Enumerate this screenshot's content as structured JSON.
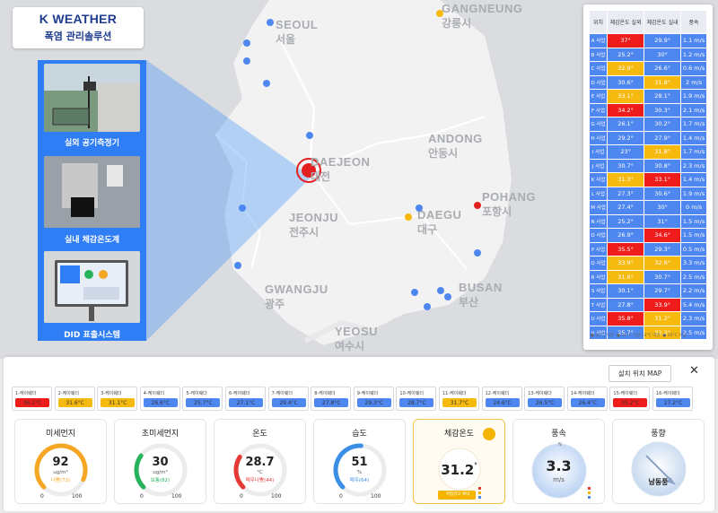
{
  "logo": {
    "brand": "K WEATHER",
    "subtitle": "폭염 관리솔루션"
  },
  "map": {
    "cities": [
      {
        "en": "SEOUL",
        "ko": "서울"
      },
      {
        "en": "GANGNEUNG",
        "ko": "강릉시"
      },
      {
        "en": "ANDONG",
        "ko": "안동시"
      },
      {
        "en": "DAEJEON",
        "ko": "대전"
      },
      {
        "en": "POHANG",
        "ko": "포항시"
      },
      {
        "en": "JEONJU",
        "ko": "전주시"
      },
      {
        "en": "DAEGU",
        "ko": "대구"
      },
      {
        "en": "BUSAN",
        "ko": "부산"
      },
      {
        "en": "GWANGJU",
        "ko": "광주"
      },
      {
        "en": "YEOSU",
        "ko": "여수시"
      }
    ]
  },
  "photos": {
    "outdoor": "실외 공기측정기",
    "indoor": "실내 체감온도계",
    "did": "DID 표출시스템"
  },
  "table": {
    "headers": [
      "위치",
      "체감온도 실외",
      "체감온도 실내",
      "풍속"
    ],
    "rows": [
      {
        "loc": "A 사업",
        "out": "37°",
        "outc": "red",
        "in": "29.9°",
        "inc": "blu",
        "wind": "1.1 m/s"
      },
      {
        "loc": "B 사업",
        "out": "25.2°",
        "outc": "blu",
        "in": "30°",
        "inc": "blu",
        "wind": "1.2 m/s"
      },
      {
        "loc": "C 사업",
        "out": "32.9°",
        "outc": "yel",
        "in": "26.6°",
        "inc": "blu",
        "wind": "0.6 m/s"
      },
      {
        "loc": "D 사업",
        "out": "30.6°",
        "outc": "blu",
        "in": "31.8°",
        "inc": "yel",
        "wind": "2 m/s"
      },
      {
        "loc": "E 사업",
        "out": "33.1°",
        "outc": "yel",
        "in": "28.1°",
        "inc": "blu",
        "wind": "1.9 m/s"
      },
      {
        "loc": "F 사업",
        "out": "34.2°",
        "outc": "red",
        "in": "30.3°",
        "inc": "blu",
        "wind": "2.1 m/s"
      },
      {
        "loc": "G 사업",
        "out": "26.1°",
        "outc": "blu",
        "in": "30.2°",
        "inc": "blu",
        "wind": "1.7 m/s"
      },
      {
        "loc": "H 사업",
        "out": "29.2°",
        "outc": "blu",
        "in": "27.9°",
        "inc": "blu",
        "wind": "1.4 m/s"
      },
      {
        "loc": "I 사업",
        "out": "23°",
        "outc": "blu",
        "in": "31.8°",
        "inc": "yel",
        "wind": "1.7 m/s"
      },
      {
        "loc": "J 사업",
        "out": "30.7°",
        "outc": "blu",
        "in": "30.8°",
        "inc": "blu",
        "wind": "2.3 m/s"
      },
      {
        "loc": "K 사업",
        "out": "31.3°",
        "outc": "yel",
        "in": "33.1°",
        "inc": "red",
        "wind": "1.4 m/s"
      },
      {
        "loc": "L 사업",
        "out": "27.3°",
        "outc": "blu",
        "in": "30.6°",
        "inc": "blu",
        "wind": "1.9 m/s"
      },
      {
        "loc": "M 사업",
        "out": "27.4°",
        "outc": "blu",
        "in": "30°",
        "inc": "blu",
        "wind": "0 m/s"
      },
      {
        "loc": "N 사업",
        "out": "25.2°",
        "outc": "blu",
        "in": "31°",
        "inc": "blu",
        "wind": "1.5 m/s"
      },
      {
        "loc": "O 사업",
        "out": "26.9°",
        "outc": "blu",
        "in": "34.6°",
        "inc": "red",
        "wind": "1.5 m/s"
      },
      {
        "loc": "P 사업",
        "out": "35.5°",
        "outc": "red",
        "in": "29.3°",
        "inc": "blu",
        "wind": "0.5 m/s"
      },
      {
        "loc": "Q 사업",
        "out": "33.9°",
        "outc": "yel",
        "in": "32.6°",
        "inc": "yel",
        "wind": "3.3 m/s"
      },
      {
        "loc": "R 사업",
        "out": "31.6°",
        "outc": "yel",
        "in": "30.7°",
        "inc": "blu",
        "wind": "2.5 m/s"
      },
      {
        "loc": "S 사업",
        "out": "30.1°",
        "outc": "blu",
        "in": "29.7°",
        "inc": "blu",
        "wind": "2.2 m/s"
      },
      {
        "loc": "T 사업",
        "out": "27.8°",
        "outc": "blu",
        "in": "33.9°",
        "inc": "red",
        "wind": "5.4 m/s"
      },
      {
        "loc": "U 사업",
        "out": "35.8°",
        "outc": "red",
        "in": "31.2°",
        "inc": "yel",
        "wind": "2.3 m/s"
      },
      {
        "loc": "V 사업",
        "out": "25.7°",
        "outc": "blu",
        "in": "32.2°",
        "inc": "yel",
        "wind": "2.5 m/s"
      }
    ]
  },
  "dashboard": {
    "map_button": "설치 위치 MAP",
    "close": "✕",
    "sensors": [
      {
        "name": "1-케이웨더",
        "value": "36.2°C",
        "color": "red"
      },
      {
        "name": "2-케이웨더",
        "value": "31.6°C",
        "color": "yel"
      },
      {
        "name": "3-케이웨더",
        "value": "31.1°C",
        "color": "yel"
      },
      {
        "name": "4-케이웨더",
        "value": "26.6°C",
        "color": "blu"
      },
      {
        "name": "5-케이웨더",
        "value": "25.7°C",
        "color": "blu"
      },
      {
        "name": "6-케이웨더",
        "value": "27.1°C",
        "color": "blu"
      },
      {
        "name": "7-케이웨더",
        "value": "29.4°C",
        "color": "blu"
      },
      {
        "name": "8-케이웨더",
        "value": "27.8°C",
        "color": "blu"
      },
      {
        "name": "9-케이웨더",
        "value": "29.3°C",
        "color": "blu"
      },
      {
        "name": "10-케이웨더",
        "value": "28.7°C",
        "color": "blu"
      },
      {
        "name": "11-케이웨더",
        "value": "31.7°C",
        "color": "yel"
      },
      {
        "name": "12-케이웨더",
        "value": "24.6°C",
        "color": "blu"
      },
      {
        "name": "13-케이웨더",
        "value": "26.5°C",
        "color": "blu"
      },
      {
        "name": "14-케이웨더",
        "value": "26.4°C",
        "color": "blu"
      },
      {
        "name": "15-케이웨더",
        "value": "35.2°C",
        "color": "red"
      },
      {
        "name": "16-케이웨더",
        "value": "27.2°C",
        "color": "blu"
      }
    ],
    "cards": {
      "pm10": {
        "title": "미세먼지",
        "value": "92",
        "unit": "ug/m³",
        "status": "나쁨(73)",
        "min": "0",
        "max": "100",
        "fraction": 0.92,
        "color": "#f5a623"
      },
      "pm25": {
        "title": "초미세먼지",
        "value": "30",
        "unit": "ug/m³",
        "status": "보통(82)",
        "min": "0",
        "max": "100",
        "fraction": 0.3,
        "color": "#27b35c"
      },
      "temp": {
        "title": "온도",
        "value": "28.7",
        "unit": "°C",
        "status": "매우나쁨(44)",
        "min": "0",
        "max": "100",
        "fraction": 0.287,
        "color": "#e53935"
      },
      "humid": {
        "title": "습도",
        "value": "51",
        "unit": "%",
        "status": "매우(64)",
        "min": "0",
        "max": "100",
        "fraction": 0.51,
        "color": "#3a8ee6"
      },
      "feels": {
        "title": "체감온도",
        "value": "31.2",
        "unit": "°",
        "badge": "위험경고 확대"
      },
      "wind": {
        "title": "풍속",
        "value": "3.3",
        "unit": "m/s"
      },
      "dir": {
        "title": "풍향",
        "value": "남동풍"
      }
    }
  },
  "colors": {
    "red": "#ef1c1c",
    "yellow": "#f6b90d",
    "blue": "#4f87f0",
    "accent": "#2f7ef5"
  }
}
